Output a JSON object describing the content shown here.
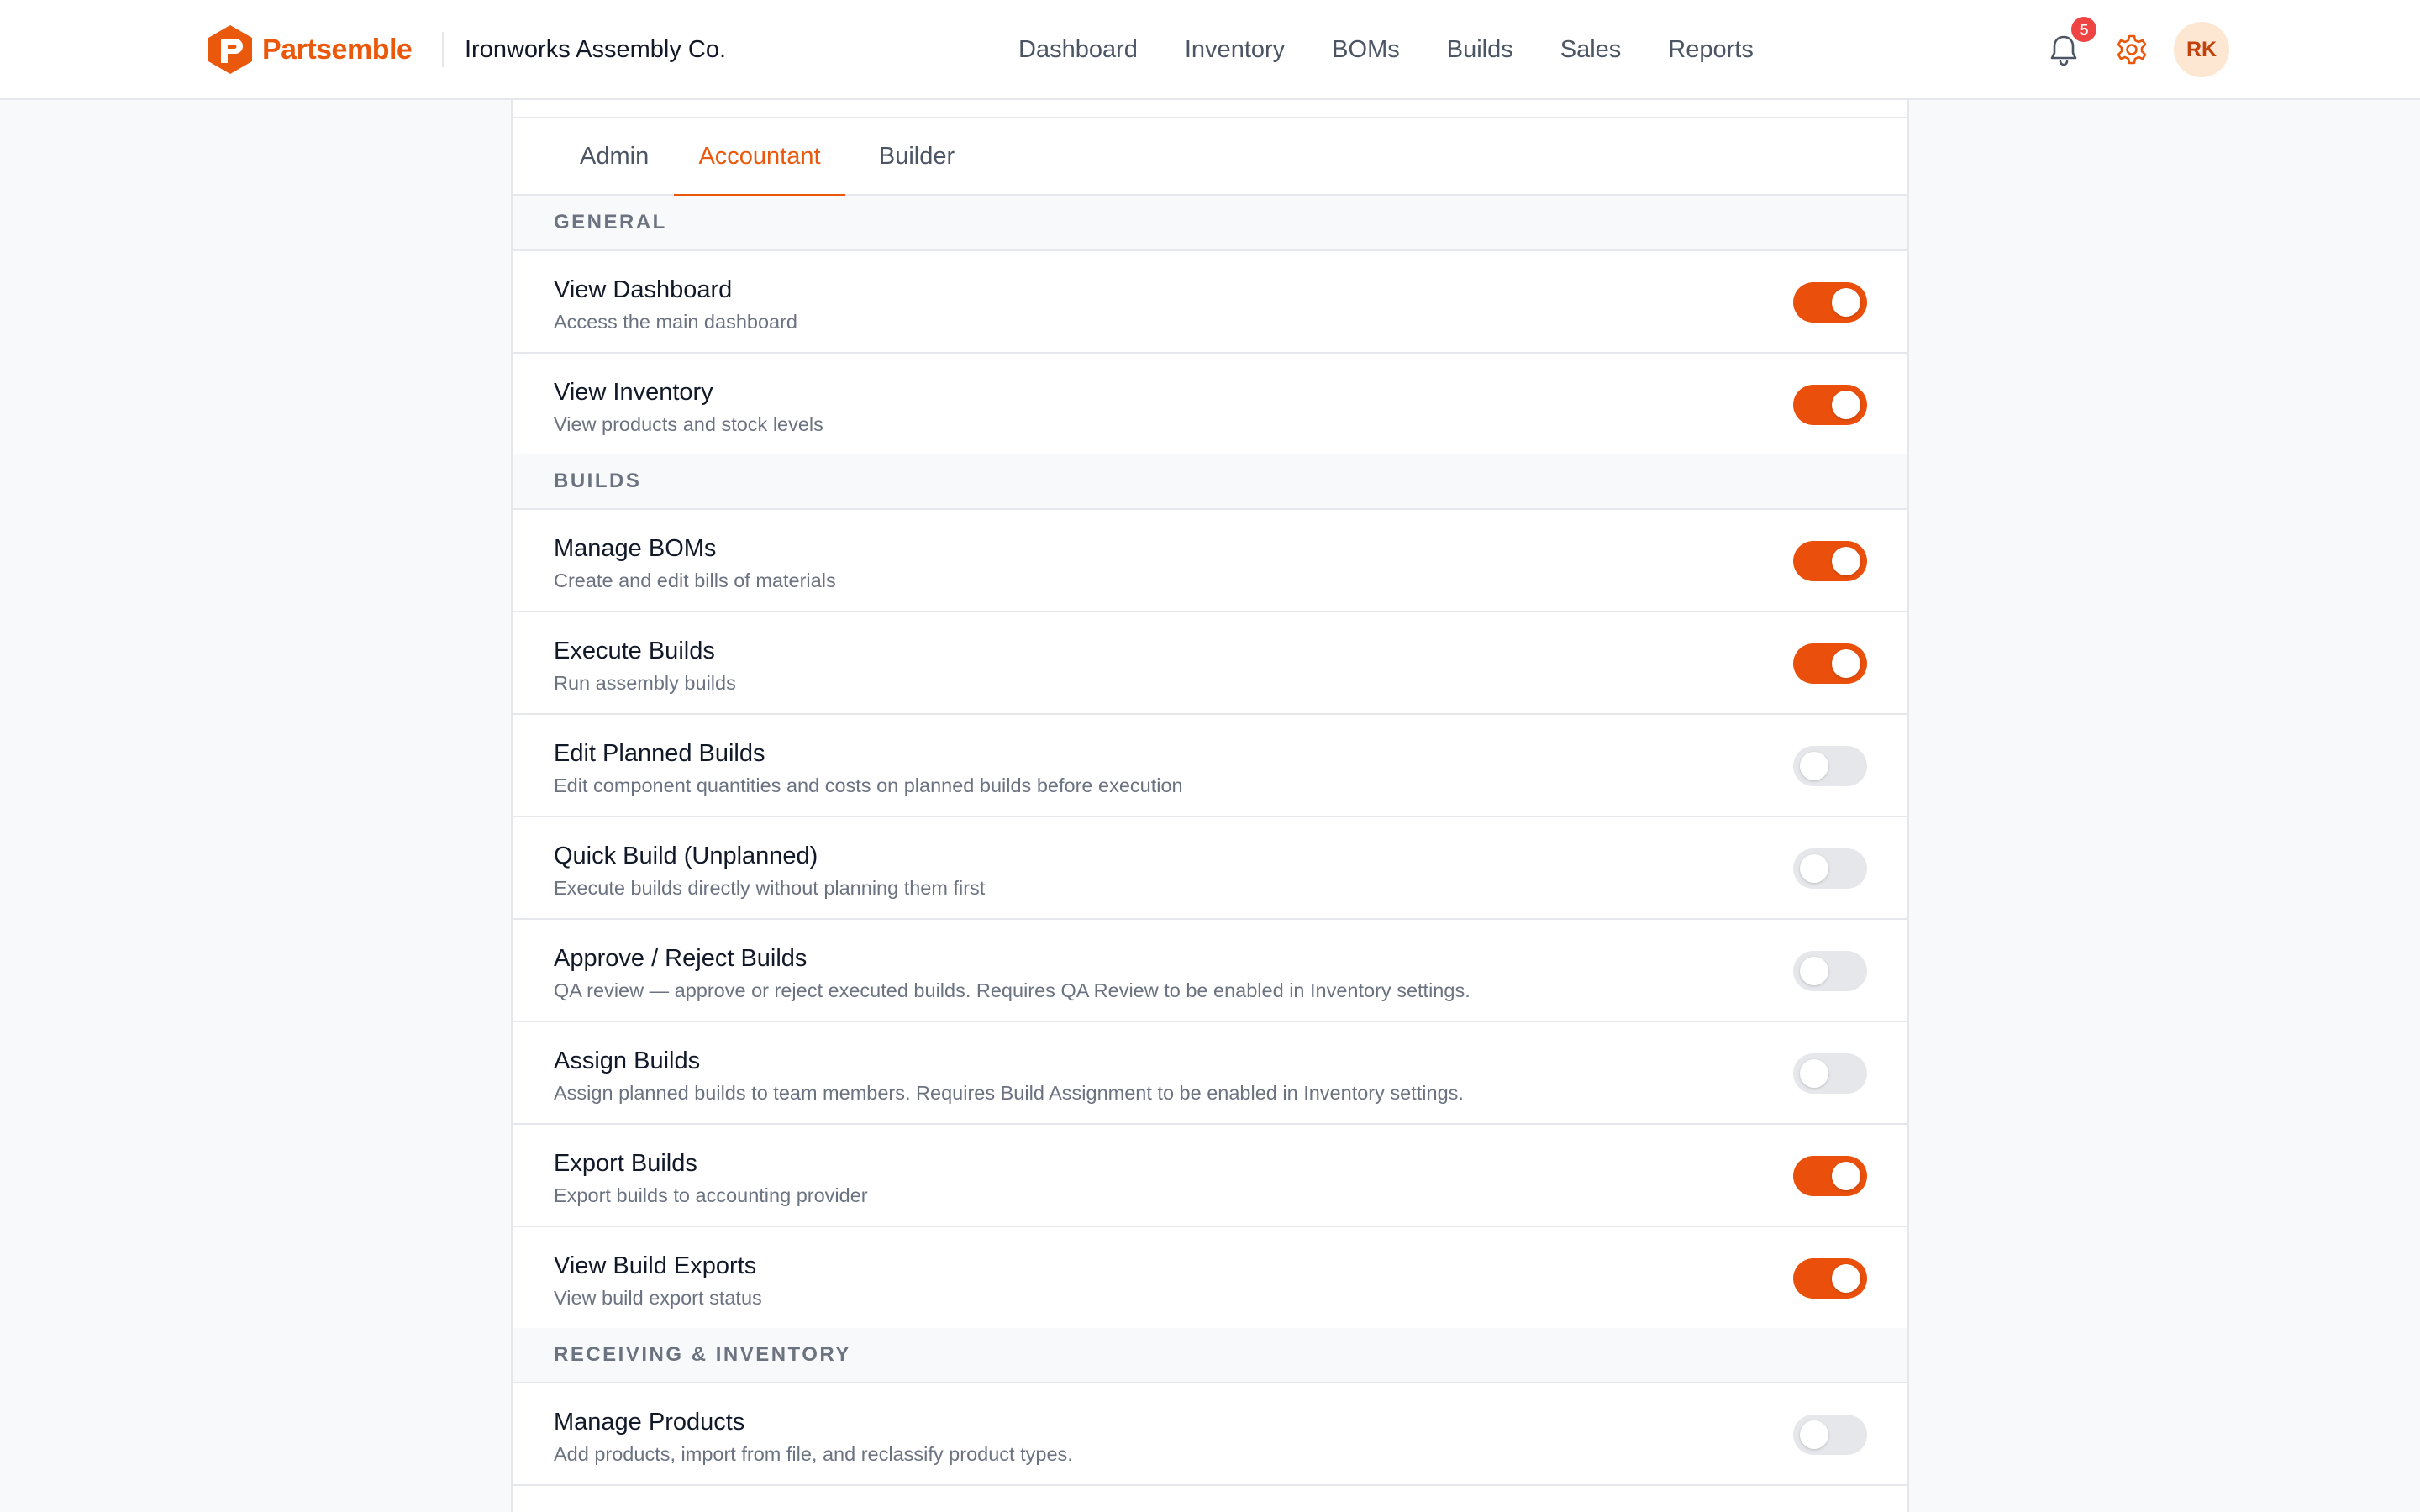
{
  "brand": {
    "name": "Partsemble",
    "color": "#ea580c"
  },
  "company": "Ironworks Assembly Co.",
  "nav": [
    {
      "label": "Dashboard",
      "name": "nav-dashboard"
    },
    {
      "label": "Inventory",
      "name": "nav-inventory"
    },
    {
      "label": "BOMs",
      "name": "nav-boms"
    },
    {
      "label": "Builds",
      "name": "nav-builds"
    },
    {
      "label": "Sales",
      "name": "nav-sales"
    },
    {
      "label": "Reports",
      "name": "nav-reports"
    }
  ],
  "header_actions": {
    "notifications_icon": "bell-icon",
    "notification_count": "5",
    "settings_icon": "gear-icon",
    "avatar_initials": "RK"
  },
  "role_tabs": [
    {
      "label": "Admin",
      "active": false
    },
    {
      "label": "Accountant",
      "active": true
    },
    {
      "label": "Builder",
      "active": false
    }
  ],
  "sections": [
    {
      "title": "GENERAL",
      "permissions": [
        {
          "title": "View Dashboard",
          "description": "Access the main dashboard",
          "enabled": true
        },
        {
          "title": "View Inventory",
          "description": "View products and stock levels",
          "enabled": true
        }
      ]
    },
    {
      "title": "BUILDS",
      "permissions": [
        {
          "title": "Manage BOMs",
          "description": "Create and edit bills of materials",
          "enabled": true
        },
        {
          "title": "Execute Builds",
          "description": "Run assembly builds",
          "enabled": true
        },
        {
          "title": "Edit Planned Builds",
          "description": "Edit component quantities and costs on planned builds before execution",
          "enabled": false
        },
        {
          "title": "Quick Build (Unplanned)",
          "description": "Execute builds directly without planning them first",
          "enabled": false
        },
        {
          "title": "Approve / Reject Builds",
          "description": "QA review — approve or reject executed builds. Requires QA Review to be enabled in Inventory settings.",
          "enabled": false
        },
        {
          "title": "Assign Builds",
          "description": "Assign planned builds to team members. Requires Build Assignment to be enabled in Inventory settings.",
          "enabled": false
        },
        {
          "title": "Export Builds",
          "description": "Export builds to accounting provider",
          "enabled": true
        },
        {
          "title": "View Build Exports",
          "description": "View build export status",
          "enabled": true
        }
      ]
    },
    {
      "title": "RECEIVING & INVENTORY",
      "permissions": [
        {
          "title": "Manage Products",
          "description": "Add products, import from file, and reclassify product types.",
          "enabled": false
        }
      ]
    }
  ],
  "colors": {
    "accent": "#ea580c",
    "toggle_on": "#ea4f0c",
    "toggle_off": "#e5e7eb",
    "badge": "#ef4444"
  }
}
